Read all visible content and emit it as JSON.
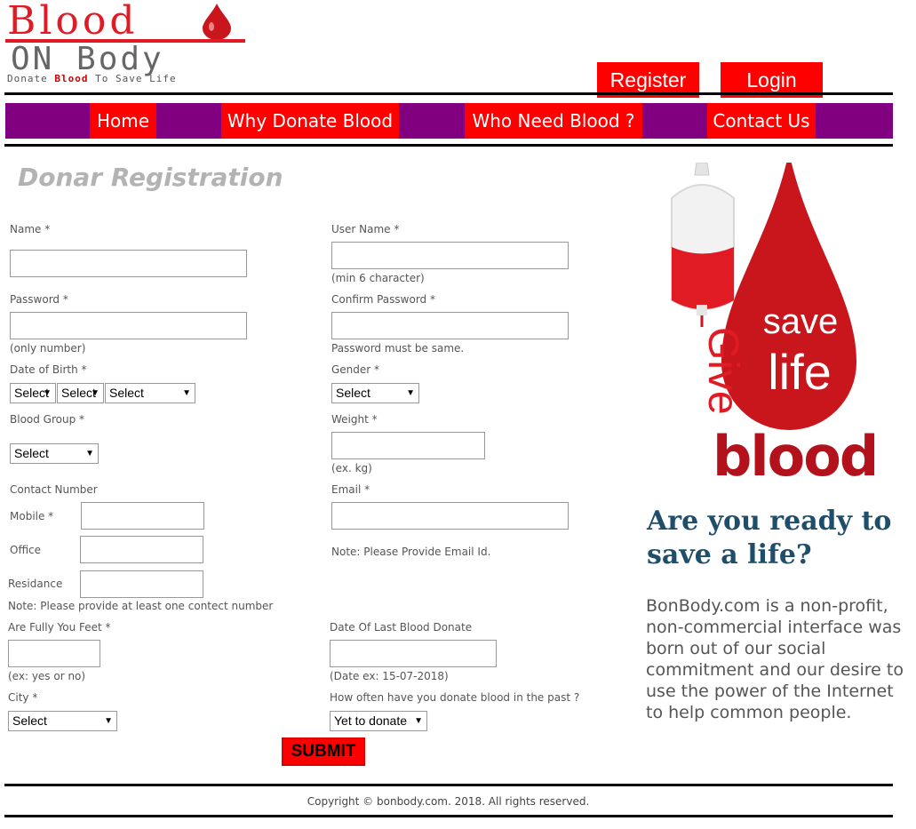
{
  "logo": {
    "title_top": "Blood",
    "title_bottom": "ON Body",
    "tagline_pre": "Donate ",
    "tagline_bold": "Blood",
    "tagline_post": " To Save Life",
    "icon": "blood-drop-icon"
  },
  "header": {
    "register_label": "Register",
    "login_label": "Login"
  },
  "nav": {
    "home": "Home",
    "why": "Why Donate Blood",
    "who": "Who Need Blood ?",
    "contact": "Contact Us"
  },
  "form": {
    "title": "Donar Registration",
    "name_label": "Name *",
    "username_label": "User Name *",
    "username_note": "(min 6 character)",
    "password_label": "Password *",
    "password_note": "(only number)",
    "confirm_label": "Confirm Password *",
    "confirm_note": "Password must be same.",
    "dob_label": "Date of Birth *",
    "dob_day": "Select",
    "dob_month": "Select",
    "dob_year": "Select",
    "gender_label": "Gender *",
    "gender_value": "Select",
    "blood_group_label": "Blood Group *",
    "blood_group_value": "Select",
    "weight_label": "Weight *",
    "weight_note": "(ex. kg)",
    "contact_label": "Contact Number",
    "mobile_label": "Mobile *",
    "office_label": "Office",
    "residance_label": "Residance",
    "contact_note": "Note: Please provide at least one contect number",
    "email_label": "Email *",
    "email_note": "Note: Please Provide Email Id.",
    "feet_label": "Are Fully You Feet *",
    "feet_note": "(ex: yes or no)",
    "last_donate_label": "Date Of Last Blood Donate",
    "last_donate_note": "(Date ex: 15-07-2018)",
    "city_label": "City *",
    "city_value": "Select",
    "how_often_label": "How often have you donate blood in the past ?",
    "how_often_value": "Yet to donate",
    "submit_label": "SUBMIT"
  },
  "hero": {
    "word_give": "Give",
    "word_save": "save",
    "word_life": "life",
    "word_blood": "blood"
  },
  "sidebar": {
    "tagline": "Are you ready to save a life?",
    "about": "BonBody.com is a non-profit, non-commercial interface was born out of our social commitment and our desire to use the power of the Internet to help common people."
  },
  "footer": {
    "copyright": "Copyright © bonbody.com. 2018. All rights reserved."
  },
  "colors": {
    "accent_red": "#ff0000",
    "nav_purple": "#800080",
    "tagline_blue": "#1f4e6b"
  }
}
